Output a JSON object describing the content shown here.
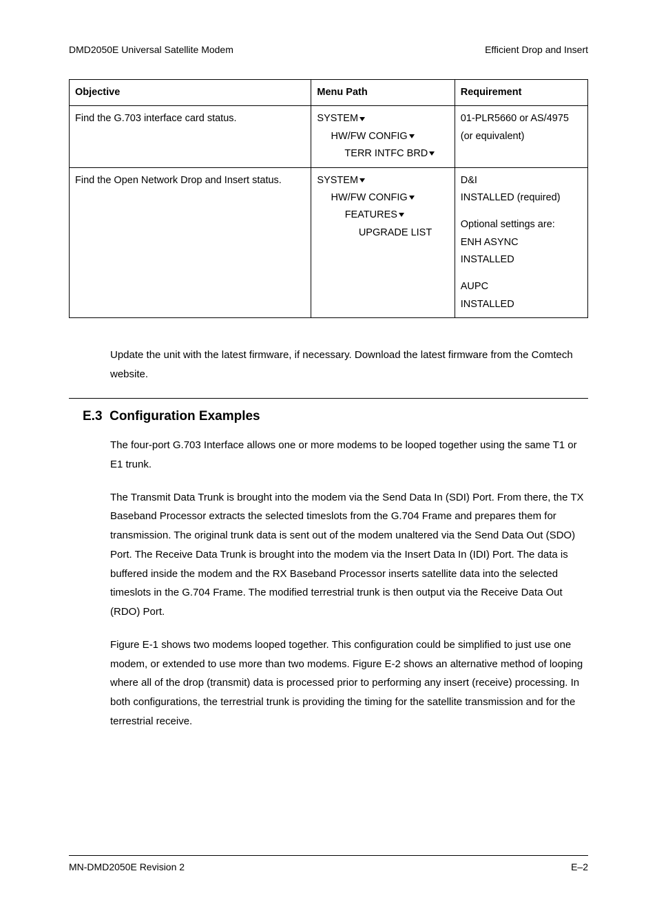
{
  "header": {
    "left": "DMD2050E Universal Satellite Modem",
    "right": "Efficient Drop and Insert"
  },
  "table": {
    "headers": [
      "Objective",
      "Menu Path",
      "Requirement"
    ],
    "rows": [
      {
        "objective": "Find the G.703 interface card status.",
        "menu": [
          {
            "indent": 0,
            "text": "SYSTEM",
            "caret": true
          },
          {
            "indent": 1,
            "text": "HW/FW CONFIG",
            "caret": true
          },
          {
            "indent": 2,
            "text": "TERR INTFC BRD",
            "caret": true
          }
        ],
        "requirement_lines": [
          "01-PLR5660 or AS/4975",
          "(or equivalent)"
        ]
      },
      {
        "objective": "Find the Open Network Drop and Insert status.",
        "menu": [
          {
            "indent": 0,
            "text": "SYSTEM",
            "caret": true
          },
          {
            "indent": 1,
            "text": "HW/FW CONFIG",
            "caret": true
          },
          {
            "indent": 2,
            "text": "FEATURES",
            "caret": true
          },
          {
            "indent": 3,
            "text": "UPGRADE LIST",
            "caret": false
          }
        ],
        "requirement_blocks": [
          [
            "D&I",
            "INSTALLED (required)"
          ],
          [
            "Optional settings are:",
            "ENH ASYNC",
            "INSTALLED"
          ],
          [
            "AUPC",
            "INSTALLED"
          ]
        ]
      }
    ]
  },
  "para1": "Update the unit with the latest firmware, if necessary. Download the latest firmware from the Comtech website.",
  "section": {
    "number": "E.3",
    "title": "Configuration Examples"
  },
  "para2": "The four-port G.703 Interface allows one or more modems to be looped together using the same T1 or E1 trunk.",
  "para3": "The Transmit Data Trunk is brought into the modem via the Send Data In (SDI) Port.  From there, the TX Baseband Processor extracts the selected timeslots from the G.704 Frame and prepares them for transmission.  The original trunk data is sent out of the modem unaltered via the Send Data Out (SDO) Port.  The Receive Data Trunk is brought into the modem via the Insert Data In (IDI) Port.  The data is buffered inside the modem and the RX Baseband Processor inserts satellite data into the selected timeslots in the G.704 Frame.  The modified terrestrial trunk is then output via the Receive Data Out (RDO) Port.",
  "para4": "Figure E-1 shows two modems looped together.  This configuration could be simplified to just use one modem, or extended to use more than two modems.  Figure E-2 shows an alternative method of looping where all of the drop (transmit) data is processed prior to performing any insert (receive) processing.  In both configurations, the terrestrial trunk is providing the timing for the satellite transmission and for the terrestrial receive.",
  "footer": {
    "left": "MN-DMD2050E   Revision 2",
    "right": "E–2"
  }
}
